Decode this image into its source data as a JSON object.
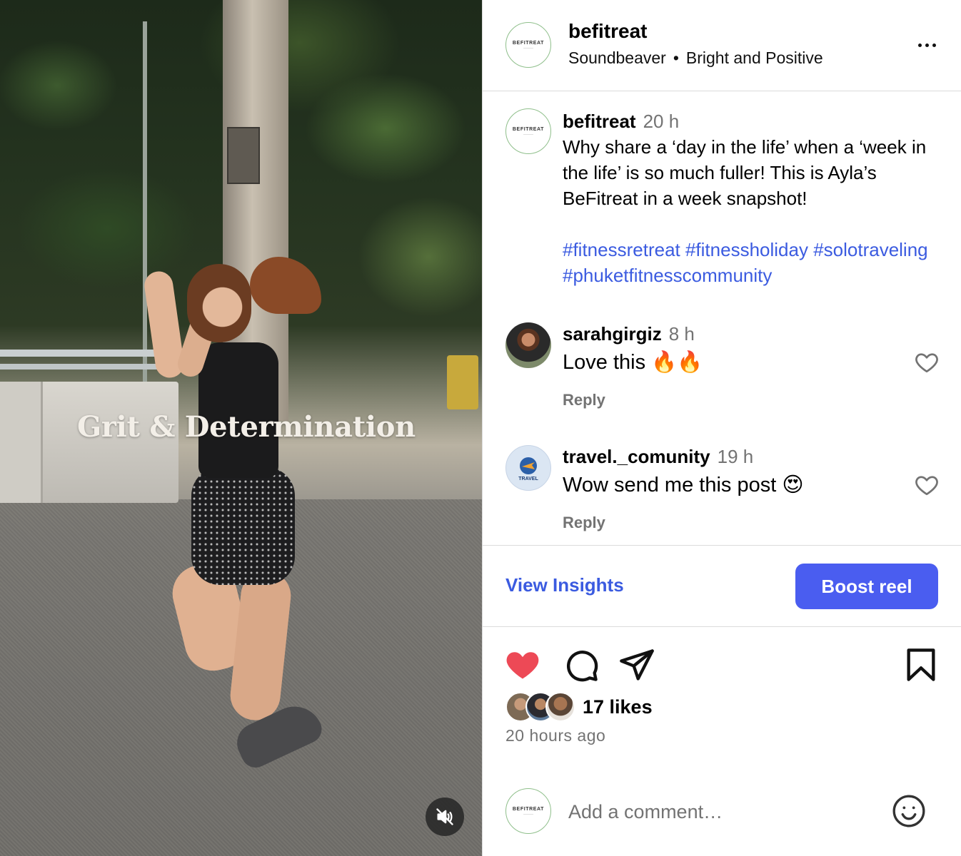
{
  "media": {
    "overlay_text": "Grit & Determination",
    "mute_icon": "speaker-muted-icon"
  },
  "header": {
    "avatar_brand": "BEFITREAT",
    "username": "befitreat",
    "audio_artist": "Soundbeaver",
    "separator": "•",
    "audio_title": "Bright and Positive",
    "more_icon": "more-horizontal-icon"
  },
  "caption": {
    "username": "befitreat",
    "time": "20 h",
    "text": "Why share a ‘day in the life’ when a ‘week in the life’ is so much fuller! This is Ayla’s BeFitreat in a week snapshot!",
    "hashtags": "#fitnessretreat #fitnessholiday #solotraveling #phuketfitnesscommunity"
  },
  "comments": [
    {
      "username": "sarahgirgiz",
      "time": "8 h",
      "text": "Love this 🔥🔥",
      "reply": "Reply"
    },
    {
      "username": "travel._comunity",
      "time": "19 h",
      "text": "Wow send me this post 😍",
      "reply": "Reply",
      "avatar_label": "TRAVEL"
    }
  ],
  "actions": {
    "view_insights": "View Insights",
    "boost": "Boost reel"
  },
  "engagement": {
    "likes": "17 likes",
    "posted_ago": "20 hours ago",
    "liked": true
  },
  "add_comment": {
    "placeholder": "Add a comment…"
  },
  "colors": {
    "link_blue": "#3b5be0",
    "boost_bg": "#4a5df0",
    "heart_red": "#ed4956",
    "muted_text": "#737373"
  }
}
